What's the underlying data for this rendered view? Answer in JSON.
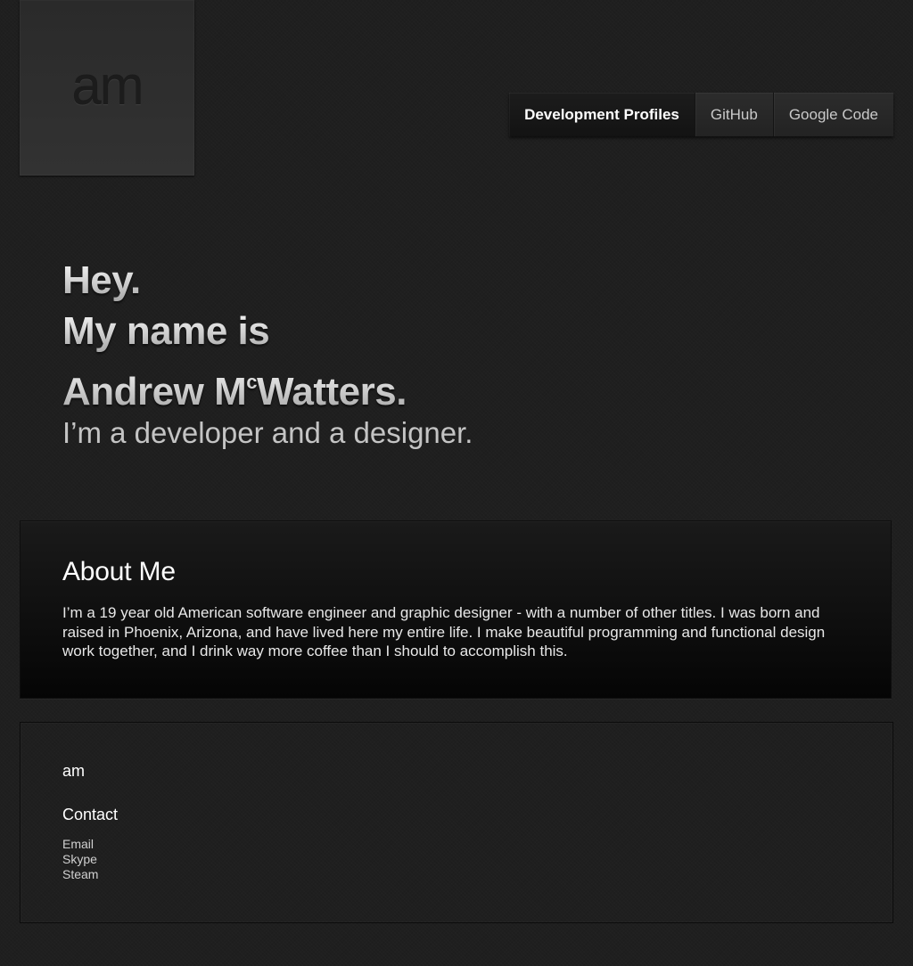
{
  "logo": {
    "text": "am"
  },
  "nav": {
    "items": [
      {
        "label": "Development Profiles"
      },
      {
        "label": "GitHub"
      },
      {
        "label": "Google Code"
      }
    ]
  },
  "hero": {
    "line1": "Hey.",
    "line2": "My name is",
    "line3_prefix": "Andrew M",
    "line3_sup": "c",
    "line3_suffix": "Watters.",
    "subtitle": "I’m a developer and a designer."
  },
  "about": {
    "title": "About Me",
    "text": "I’m a 19 year old American software engineer and graphic designer - with a number of other titles. I was born and raised in Phoenix, Arizona, and have lived here my entire life. I make beautiful programming and functional design work together, and I drink way more coffee than I should to accomplish this."
  },
  "footer": {
    "brand": "am",
    "contact_heading": "Contact",
    "contact_links": [
      {
        "label": "Email"
      },
      {
        "label": "Skype"
      },
      {
        "label": "Steam"
      }
    ]
  }
}
